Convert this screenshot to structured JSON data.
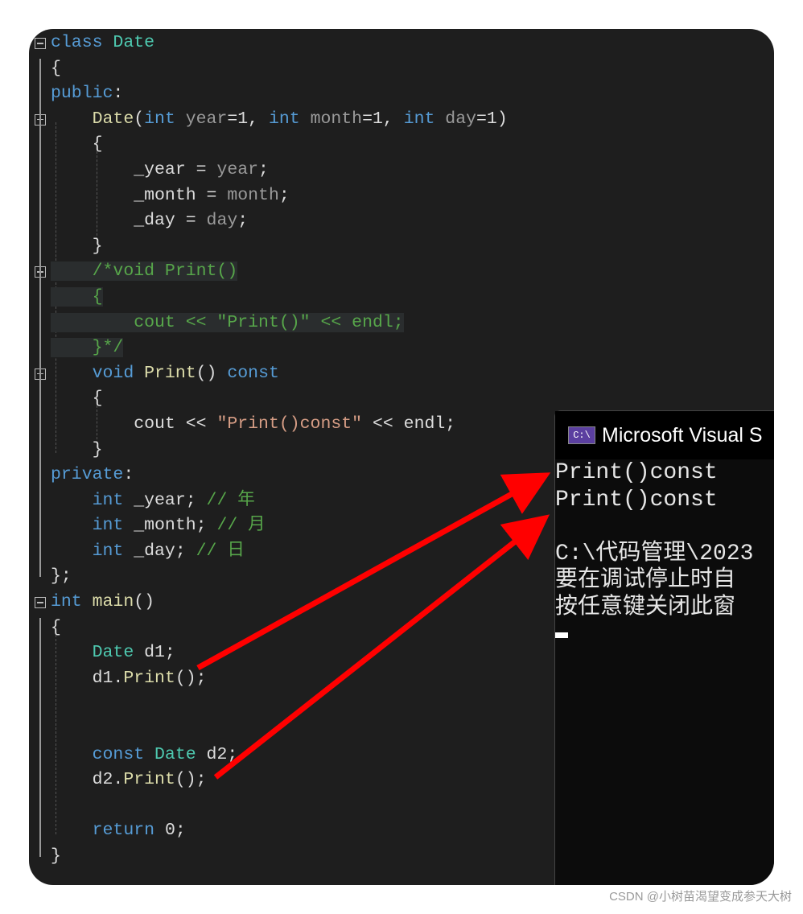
{
  "editor": {
    "lines": [
      [
        [
          "class ",
          "k"
        ],
        [
          "Date",
          "t"
        ]
      ],
      [
        [
          "{",
          "n"
        ]
      ],
      [
        [
          "public",
          "k"
        ],
        [
          ":",
          "n"
        ]
      ],
      [
        [
          "    ",
          "n"
        ],
        [
          "Date",
          "f"
        ],
        [
          "(",
          "n"
        ],
        [
          "int ",
          "k"
        ],
        [
          "year",
          "p"
        ],
        [
          "=1, ",
          "n"
        ],
        [
          "int ",
          "k"
        ],
        [
          "month",
          "p"
        ],
        [
          "=1, ",
          "n"
        ],
        [
          "int ",
          "k"
        ],
        [
          "day",
          "p"
        ],
        [
          "=1)",
          "n"
        ]
      ],
      [
        [
          "    {",
          "n"
        ]
      ],
      [
        [
          "        _year = ",
          "n"
        ],
        [
          "year",
          "p"
        ],
        [
          ";",
          "n"
        ]
      ],
      [
        [
          "        _month = ",
          "n"
        ],
        [
          "month",
          "p"
        ],
        [
          ";",
          "n"
        ]
      ],
      [
        [
          "        _day = ",
          "n"
        ],
        [
          "day",
          "p"
        ],
        [
          ";",
          "n"
        ]
      ],
      [
        [
          "    }",
          "n"
        ]
      ],
      [
        [
          "    /*void Print()",
          "c"
        ]
      ],
      [
        [
          "    {",
          "c"
        ]
      ],
      [
        [
          "        cout << \"Print()\" << endl;",
          "c"
        ]
      ],
      [
        [
          "    }*/",
          "c"
        ]
      ],
      [
        [
          "    ",
          "n"
        ],
        [
          "void ",
          "k"
        ],
        [
          "Print",
          "f"
        ],
        [
          "() ",
          "n"
        ],
        [
          "const",
          "k"
        ]
      ],
      [
        [
          "    {",
          "n"
        ]
      ],
      [
        [
          "        cout << ",
          "n"
        ],
        [
          "\"Print()const\"",
          "s"
        ],
        [
          " << endl;",
          "n"
        ]
      ],
      [
        [
          "    }",
          "n"
        ]
      ],
      [
        [
          "private",
          "k"
        ],
        [
          ":",
          "n"
        ]
      ],
      [
        [
          "    ",
          "n"
        ],
        [
          "int ",
          "k"
        ],
        [
          "_year; ",
          "n"
        ],
        [
          "// 年",
          "c"
        ]
      ],
      [
        [
          "    ",
          "n"
        ],
        [
          "int ",
          "k"
        ],
        [
          "_month; ",
          "n"
        ],
        [
          "// 月",
          "c"
        ]
      ],
      [
        [
          "    ",
          "n"
        ],
        [
          "int ",
          "k"
        ],
        [
          "_day; ",
          "n"
        ],
        [
          "// 日",
          "c"
        ]
      ],
      [
        [
          "};",
          "n"
        ]
      ],
      [
        [
          "int ",
          "k"
        ],
        [
          "main",
          "f"
        ],
        [
          "()",
          "n"
        ]
      ],
      [
        [
          "{",
          "n"
        ]
      ],
      [
        [
          "    ",
          "n"
        ],
        [
          "Date ",
          "t"
        ],
        [
          "d1;",
          "n"
        ]
      ],
      [
        [
          "    d1.",
          "n"
        ],
        [
          "Print",
          "f"
        ],
        [
          "();",
          "n"
        ]
      ],
      [],
      [],
      [
        [
          "    ",
          "n"
        ],
        [
          "const ",
          "k"
        ],
        [
          "Date ",
          "t"
        ],
        [
          "d2;",
          "n"
        ]
      ],
      [
        [
          "    d2.",
          "n"
        ],
        [
          "Print",
          "f"
        ],
        [
          "();",
          "n"
        ]
      ],
      [],
      [
        [
          "    ",
          "n"
        ],
        [
          "return ",
          "k"
        ],
        [
          "0;",
          "n"
        ]
      ],
      [
        [
          "}",
          "n"
        ]
      ]
    ]
  },
  "console": {
    "title": "Microsoft Visual S",
    "icon": "console-app-icon",
    "icon_text": "C:\\",
    "output": [
      "Print()const",
      "Print()const",
      "",
      "C:\\代码管理\\2023",
      "要在调试停止时自",
      "按任意键关闭此窗"
    ]
  },
  "annotation": {
    "arrow_color": "#ff0000"
  },
  "watermark": "CSDN @小树苗渴望变成参天大树"
}
